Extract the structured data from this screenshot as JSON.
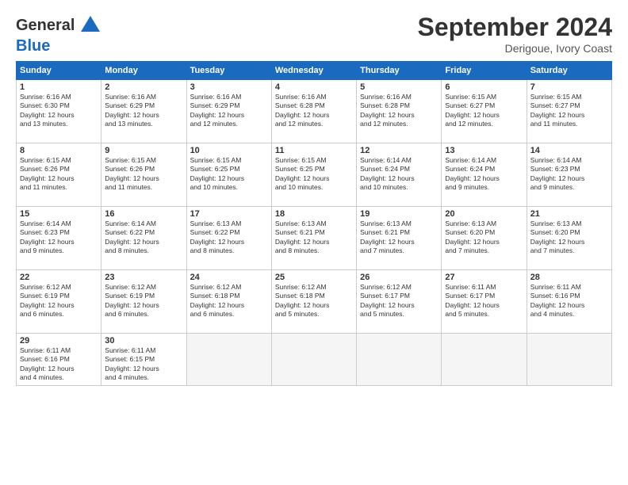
{
  "header": {
    "logo_line1": "General",
    "logo_line2": "Blue",
    "month": "September 2024",
    "location": "Derigoue, Ivory Coast"
  },
  "weekdays": [
    "Sunday",
    "Monday",
    "Tuesday",
    "Wednesday",
    "Thursday",
    "Friday",
    "Saturday"
  ],
  "weeks": [
    [
      {
        "day": "1",
        "rise": "6:16 AM",
        "set": "6:30 PM",
        "daylight": "12 hours and 13 minutes."
      },
      {
        "day": "2",
        "rise": "6:16 AM",
        "set": "6:29 PM",
        "daylight": "12 hours and 13 minutes."
      },
      {
        "day": "3",
        "rise": "6:16 AM",
        "set": "6:29 PM",
        "daylight": "12 hours and 12 minutes."
      },
      {
        "day": "4",
        "rise": "6:16 AM",
        "set": "6:28 PM",
        "daylight": "12 hours and 12 minutes."
      },
      {
        "day": "5",
        "rise": "6:16 AM",
        "set": "6:28 PM",
        "daylight": "12 hours and 12 minutes."
      },
      {
        "day": "6",
        "rise": "6:15 AM",
        "set": "6:27 PM",
        "daylight": "12 hours and 12 minutes."
      },
      {
        "day": "7",
        "rise": "6:15 AM",
        "set": "6:27 PM",
        "daylight": "12 hours and 11 minutes."
      }
    ],
    [
      {
        "day": "8",
        "rise": "6:15 AM",
        "set": "6:26 PM",
        "daylight": "12 hours and 11 minutes."
      },
      {
        "day": "9",
        "rise": "6:15 AM",
        "set": "6:26 PM",
        "daylight": "12 hours and 11 minutes."
      },
      {
        "day": "10",
        "rise": "6:15 AM",
        "set": "6:25 PM",
        "daylight": "12 hours and 10 minutes."
      },
      {
        "day": "11",
        "rise": "6:15 AM",
        "set": "6:25 PM",
        "daylight": "12 hours and 10 minutes."
      },
      {
        "day": "12",
        "rise": "6:14 AM",
        "set": "6:24 PM",
        "daylight": "12 hours and 10 minutes."
      },
      {
        "day": "13",
        "rise": "6:14 AM",
        "set": "6:24 PM",
        "daylight": "12 hours and 9 minutes."
      },
      {
        "day": "14",
        "rise": "6:14 AM",
        "set": "6:23 PM",
        "daylight": "12 hours and 9 minutes."
      }
    ],
    [
      {
        "day": "15",
        "rise": "6:14 AM",
        "set": "6:23 PM",
        "daylight": "12 hours and 9 minutes."
      },
      {
        "day": "16",
        "rise": "6:14 AM",
        "set": "6:22 PM",
        "daylight": "12 hours and 8 minutes."
      },
      {
        "day": "17",
        "rise": "6:13 AM",
        "set": "6:22 PM",
        "daylight": "12 hours and 8 minutes."
      },
      {
        "day": "18",
        "rise": "6:13 AM",
        "set": "6:21 PM",
        "daylight": "12 hours and 8 minutes."
      },
      {
        "day": "19",
        "rise": "6:13 AM",
        "set": "6:21 PM",
        "daylight": "12 hours and 7 minutes."
      },
      {
        "day": "20",
        "rise": "6:13 AM",
        "set": "6:20 PM",
        "daylight": "12 hours and 7 minutes."
      },
      {
        "day": "21",
        "rise": "6:13 AM",
        "set": "6:20 PM",
        "daylight": "12 hours and 7 minutes."
      }
    ],
    [
      {
        "day": "22",
        "rise": "6:12 AM",
        "set": "6:19 PM",
        "daylight": "12 hours and 6 minutes."
      },
      {
        "day": "23",
        "rise": "6:12 AM",
        "set": "6:19 PM",
        "daylight": "12 hours and 6 minutes."
      },
      {
        "day": "24",
        "rise": "6:12 AM",
        "set": "6:18 PM",
        "daylight": "12 hours and 6 minutes."
      },
      {
        "day": "25",
        "rise": "6:12 AM",
        "set": "6:18 PM",
        "daylight": "12 hours and 5 minutes."
      },
      {
        "day": "26",
        "rise": "6:12 AM",
        "set": "6:17 PM",
        "daylight": "12 hours and 5 minutes."
      },
      {
        "day": "27",
        "rise": "6:11 AM",
        "set": "6:17 PM",
        "daylight": "12 hours and 5 minutes."
      },
      {
        "day": "28",
        "rise": "6:11 AM",
        "set": "6:16 PM",
        "daylight": "12 hours and 4 minutes."
      }
    ],
    [
      {
        "day": "29",
        "rise": "6:11 AM",
        "set": "6:16 PM",
        "daylight": "12 hours and 4 minutes."
      },
      {
        "day": "30",
        "rise": "6:11 AM",
        "set": "6:15 PM",
        "daylight": "12 hours and 4 minutes."
      },
      null,
      null,
      null,
      null,
      null
    ]
  ]
}
